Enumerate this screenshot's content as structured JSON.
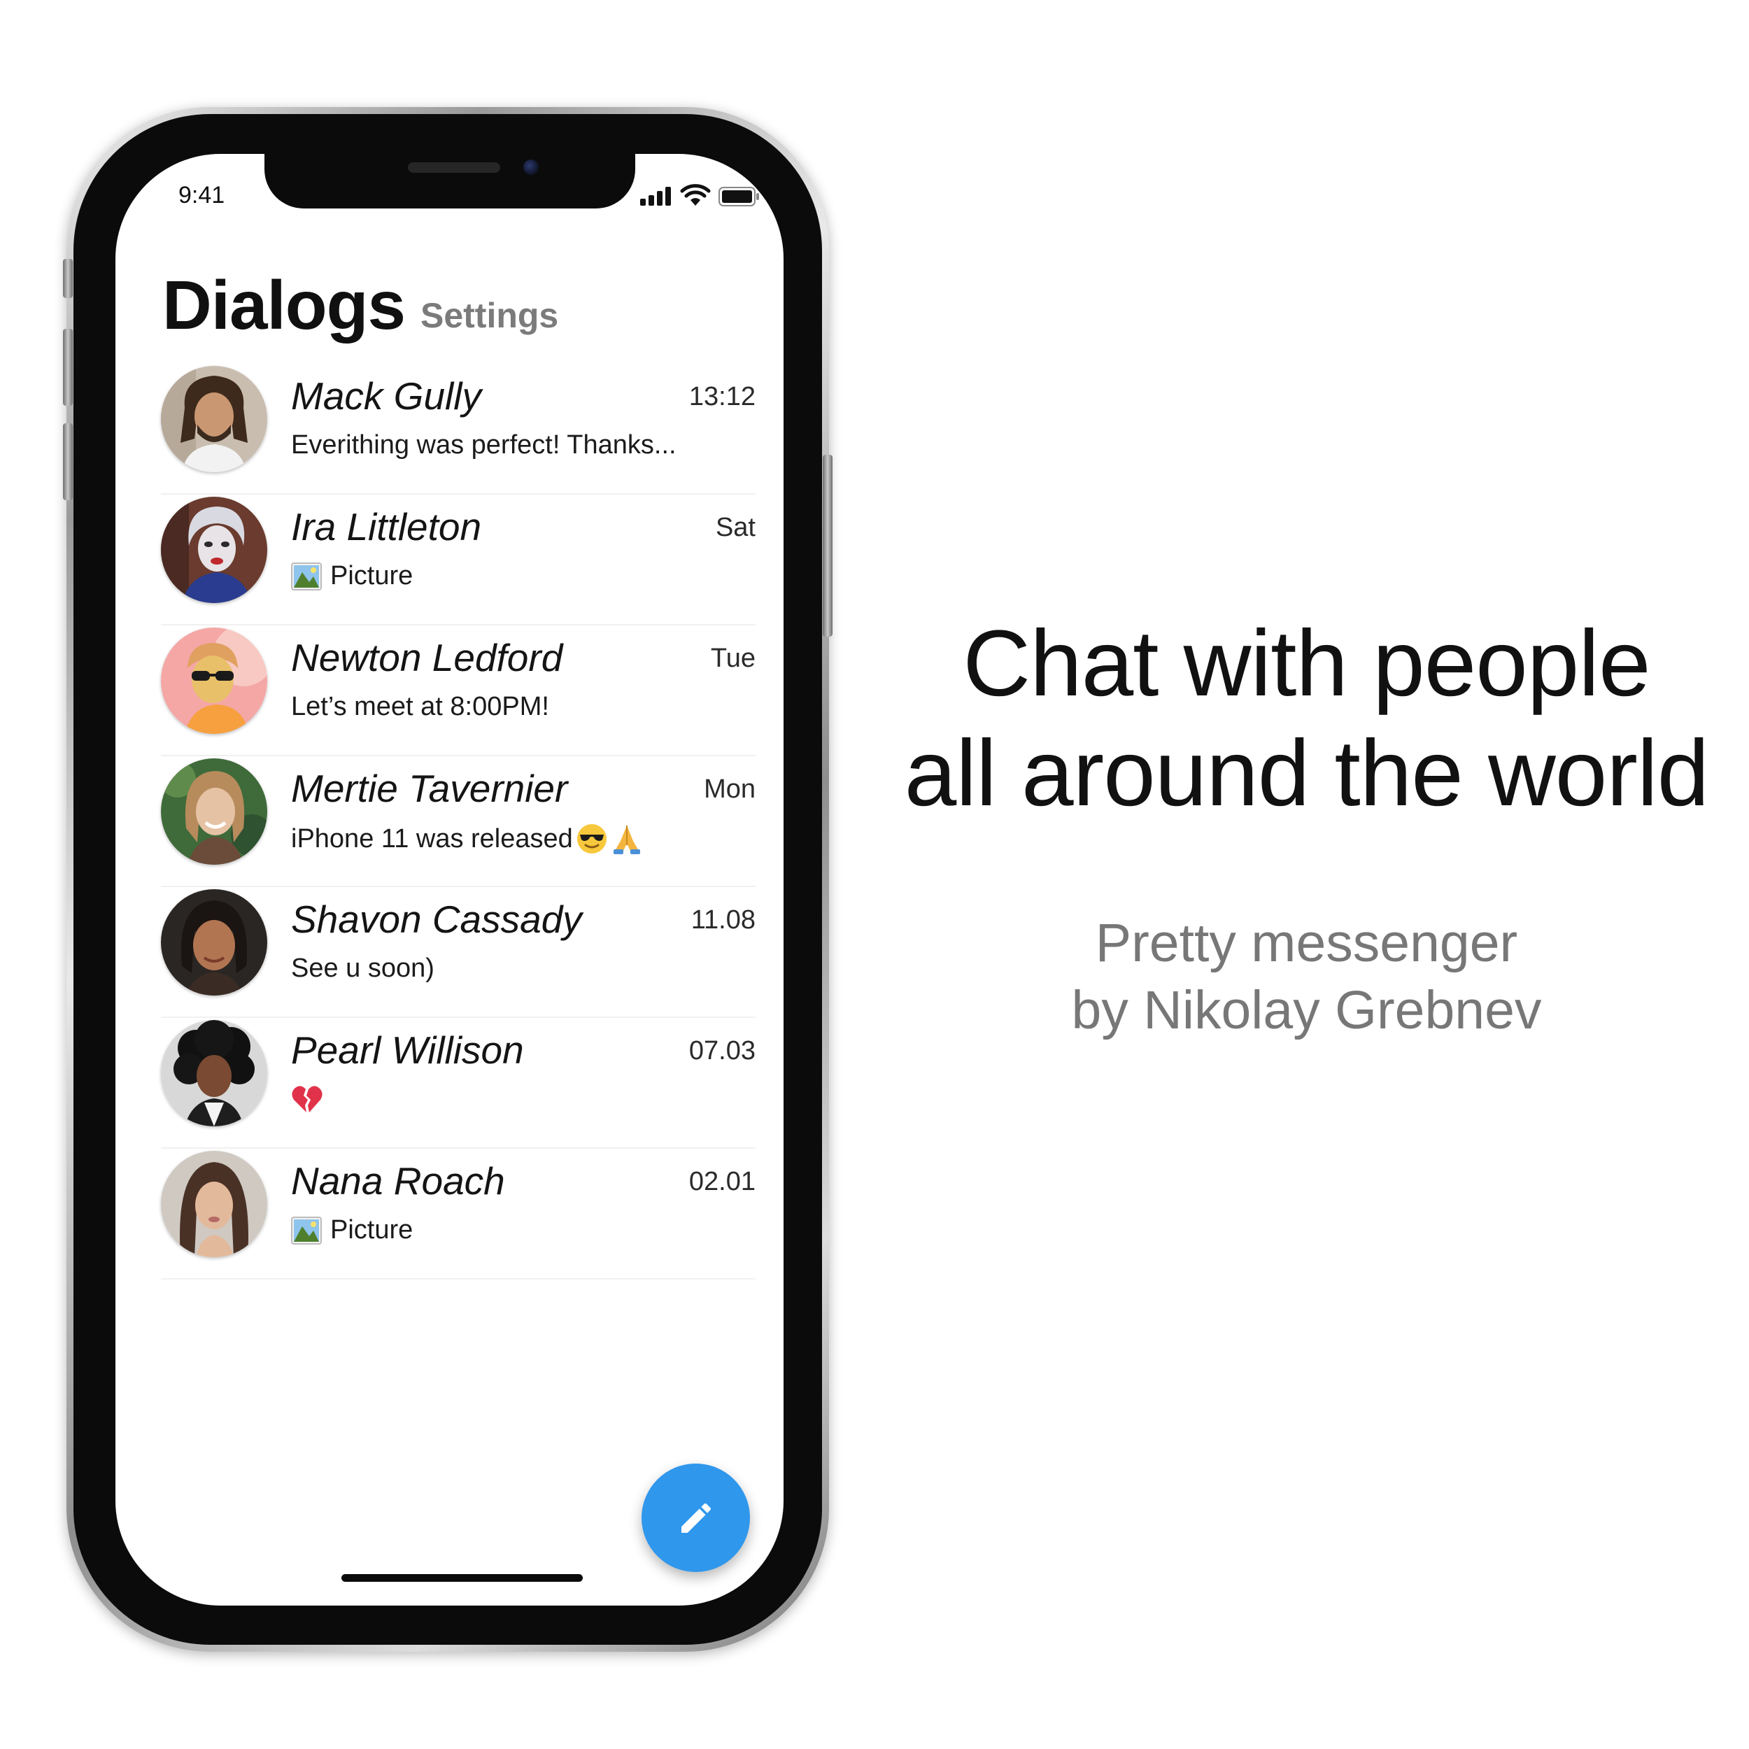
{
  "status_bar": {
    "time": "9:41"
  },
  "header": {
    "title": "Dialogs",
    "settings_label": "Settings"
  },
  "dialogs": [
    {
      "name": "Mack Gully",
      "time": "13:12",
      "preview": "Everithing was perfect! Thanks...",
      "avatar": "man-dreadlocks-avatar"
    },
    {
      "name": "Ira Littleton",
      "time": "Sat",
      "preview": "Picture",
      "preview_icon": "picture-icon",
      "avatar": "person-face-paint-avatar"
    },
    {
      "name": "Newton Ledford",
      "time": "Tue",
      "preview": "Let’s meet at 8:00PM!",
      "avatar": "man-sunglasses-avatar"
    },
    {
      "name": "Mertie Tavernier",
      "time": "Mon",
      "preview": "iPhone 11 was released",
      "preview_emoji": [
        "sunglasses-emoji",
        "folded-hands-emoji"
      ],
      "avatar": "woman-smiling-avatar"
    },
    {
      "name": "Shavon Cassady",
      "time": "11.08",
      "preview": "See u soon)",
      "avatar": "woman-dark-hair-avatar"
    },
    {
      "name": "Pearl Willison",
      "time": "07.03",
      "preview": "",
      "preview_emoji": [
        "broken-heart-emoji"
      ],
      "avatar": "person-curly-hair-avatar"
    },
    {
      "name": "Nana Roach",
      "time": "02.01",
      "preview": "Picture",
      "preview_icon": "picture-icon",
      "avatar": "woman-long-hair-avatar"
    }
  ],
  "fab": {
    "icon": "pencil-icon",
    "color": "#2f97ec"
  },
  "promo": {
    "headline_line1": "Chat with people",
    "headline_line2": "all around the world",
    "subline_line1": "Pretty messenger",
    "subline_line2": "by Nikolay Grebnev"
  }
}
